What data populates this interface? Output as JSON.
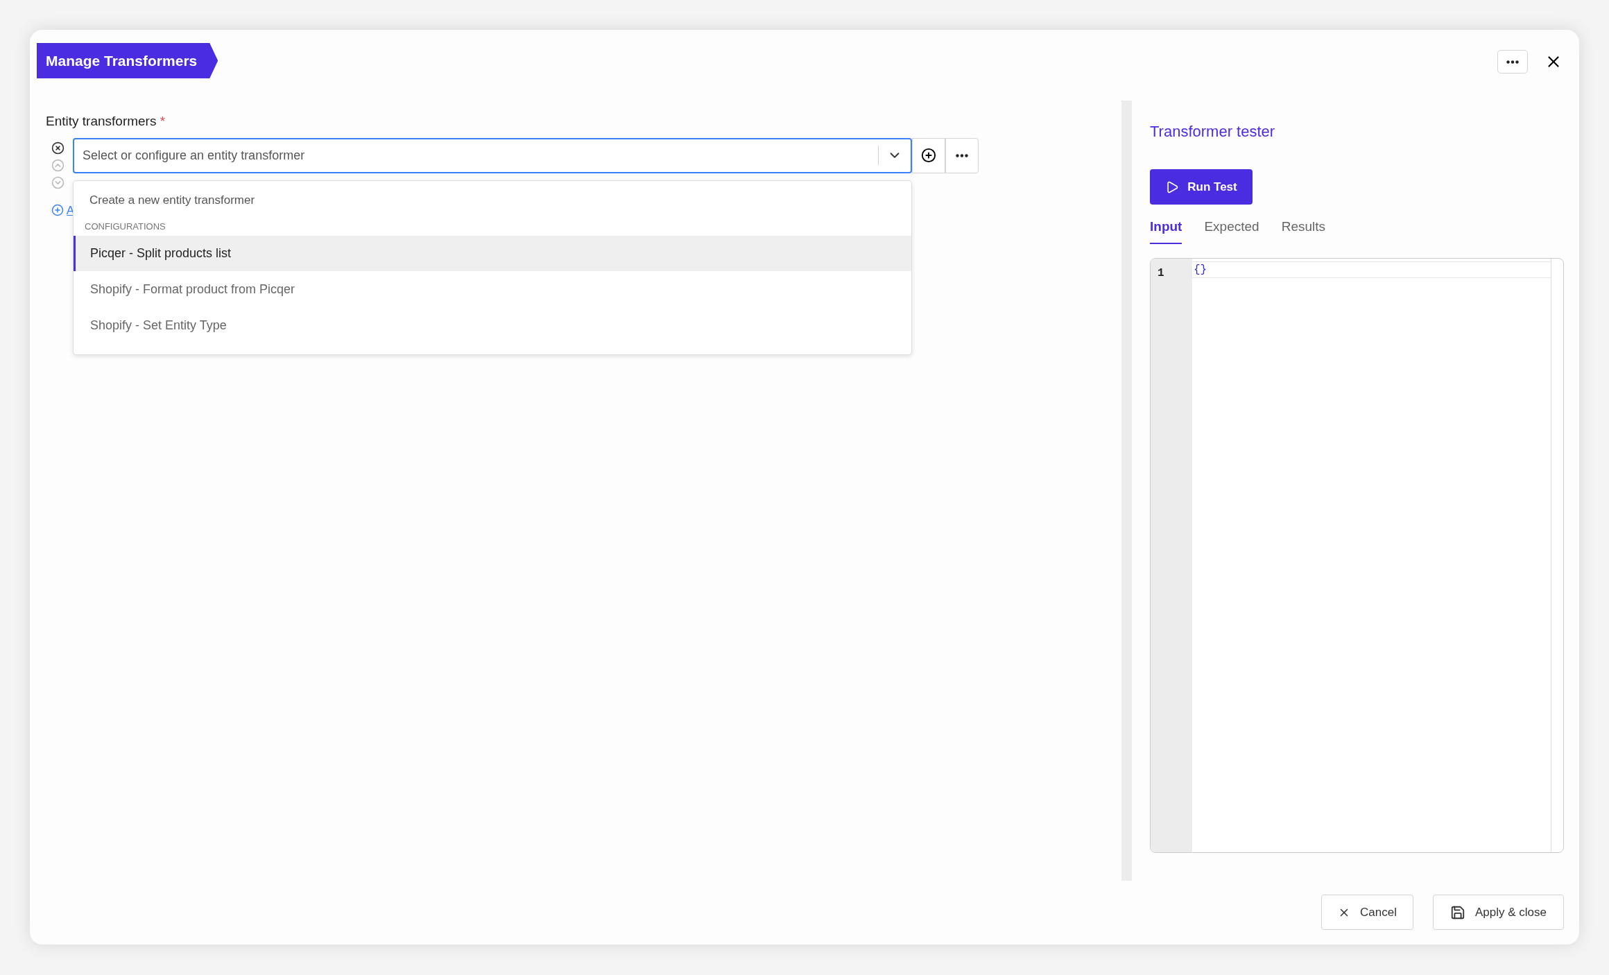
{
  "dialog": {
    "title": "Manage Transformers"
  },
  "field": {
    "label": "Entity transformers",
    "required_mark": "*",
    "placeholder": "Select or configure an entity transformer"
  },
  "add_link": {
    "label": "A"
  },
  "dropdown": {
    "create_option": "Create a new entity transformer",
    "group_label": "CONFIGURATIONS",
    "options": [
      {
        "label": "Picqer - Split products list",
        "selected": true
      },
      {
        "label": "Shopify - Format product from Picqer",
        "selected": false
      },
      {
        "label": "Shopify - Set Entity Type",
        "selected": false
      }
    ]
  },
  "tester": {
    "title": "Transformer tester",
    "run_button": "Run Test",
    "tabs": [
      {
        "label": "Input",
        "selected": true
      },
      {
        "label": "Expected",
        "selected": false
      },
      {
        "label": "Results",
        "selected": false
      }
    ],
    "editor": {
      "line_number": "1",
      "code": "{}"
    }
  },
  "footer": {
    "cancel": "Cancel",
    "apply": "Apply & close"
  }
}
